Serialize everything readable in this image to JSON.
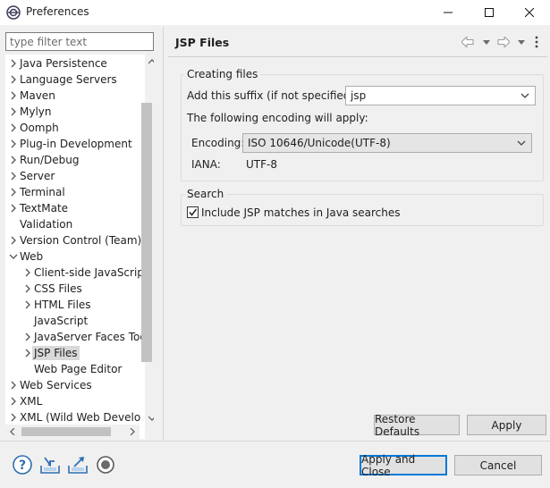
{
  "window": {
    "title": "Preferences"
  },
  "filter": {
    "placeholder": "type filter text"
  },
  "tree": {
    "items": [
      {
        "label": "Java Persistence",
        "level": 0,
        "expander": "collapsed"
      },
      {
        "label": "Language Servers",
        "level": 0,
        "expander": "collapsed"
      },
      {
        "label": "Maven",
        "level": 0,
        "expander": "collapsed"
      },
      {
        "label": "Mylyn",
        "level": 0,
        "expander": "collapsed"
      },
      {
        "label": "Oomph",
        "level": 0,
        "expander": "collapsed"
      },
      {
        "label": "Plug-in Development",
        "level": 0,
        "expander": "collapsed"
      },
      {
        "label": "Run/Debug",
        "level": 0,
        "expander": "collapsed"
      },
      {
        "label": "Server",
        "level": 0,
        "expander": "collapsed"
      },
      {
        "label": "Terminal",
        "level": 0,
        "expander": "collapsed"
      },
      {
        "label": "TextMate",
        "level": 0,
        "expander": "collapsed"
      },
      {
        "label": "Validation",
        "level": 0,
        "expander": "none"
      },
      {
        "label": "Version Control (Team)",
        "level": 0,
        "expander": "collapsed"
      },
      {
        "label": "Web",
        "level": 0,
        "expander": "expanded"
      },
      {
        "label": "Client-side JavaScript",
        "level": 1,
        "expander": "collapsed"
      },
      {
        "label": "CSS Files",
        "level": 1,
        "expander": "collapsed"
      },
      {
        "label": "HTML Files",
        "level": 1,
        "expander": "collapsed"
      },
      {
        "label": "JavaScript",
        "level": 1,
        "expander": "none"
      },
      {
        "label": "JavaServer Faces Tools",
        "level": 1,
        "expander": "collapsed"
      },
      {
        "label": "JSP Files",
        "level": 1,
        "expander": "collapsed",
        "selected": true
      },
      {
        "label": "Web Page Editor",
        "level": 1,
        "expander": "none"
      },
      {
        "label": "Web Services",
        "level": 0,
        "expander": "collapsed"
      },
      {
        "label": "XML",
        "level": 0,
        "expander": "collapsed"
      },
      {
        "label": "XML (Wild Web Developer)",
        "level": 0,
        "expander": "collapsed"
      }
    ]
  },
  "page": {
    "title": "JSP Files"
  },
  "creating_files": {
    "group_label": "Creating files",
    "suffix_label": "Add this suffix (if not specified):",
    "suffix_value": "jsp",
    "encoding_note": "The following encoding will apply:",
    "encoding_label": "Encoding:",
    "encoding_value": "ISO 10646/Unicode(UTF-8)",
    "iana_label": "IANA:",
    "iana_value": "UTF-8"
  },
  "search": {
    "group_label": "Search",
    "include_label": "Include JSP matches in Java searches",
    "include_checked": true
  },
  "buttons": {
    "restore_defaults": "Restore Defaults",
    "apply": "Apply",
    "apply_and_close": "Apply and Close",
    "cancel": "Cancel"
  },
  "colors": {
    "accent": "#0078d7",
    "icon_blue": "#2f6fb2"
  }
}
